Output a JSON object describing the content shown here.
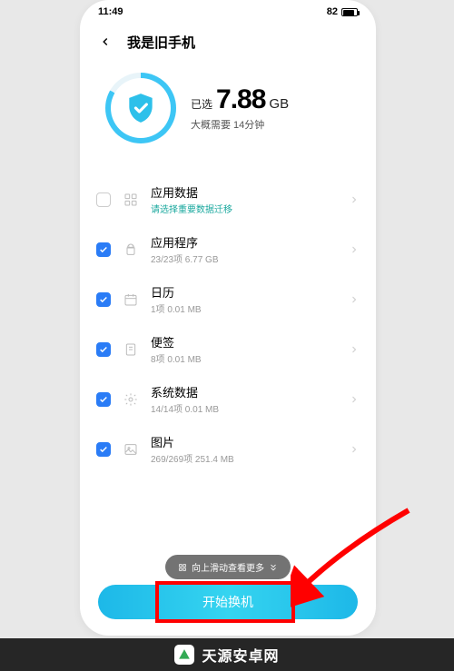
{
  "status": {
    "time": "11:49",
    "battery": "82"
  },
  "header": {
    "title": "我是旧手机"
  },
  "summary": {
    "selected_label": "已选",
    "size_value": "7.88",
    "size_unit": "GB",
    "estimate": "大概需要 14分钟"
  },
  "items": [
    {
      "title": "应用数据",
      "sub": "请选择重要数据迁移",
      "checked": false,
      "warn": true
    },
    {
      "title": "应用程序",
      "sub": "23/23项  6.77 GB",
      "checked": true,
      "warn": false
    },
    {
      "title": "日历",
      "sub": "1项  0.01 MB",
      "checked": true,
      "warn": false
    },
    {
      "title": "便签",
      "sub": "8项  0.01 MB",
      "checked": true,
      "warn": false
    },
    {
      "title": "系统数据",
      "sub": "14/14项  0.01 MB",
      "checked": true,
      "warn": false
    },
    {
      "title": "图片",
      "sub": "269/269项  251.4 MB",
      "checked": true,
      "warn": false
    }
  ],
  "scroll_hint": "向上滑动查看更多",
  "start_button": "开始换机",
  "footer": "天源安卓网"
}
